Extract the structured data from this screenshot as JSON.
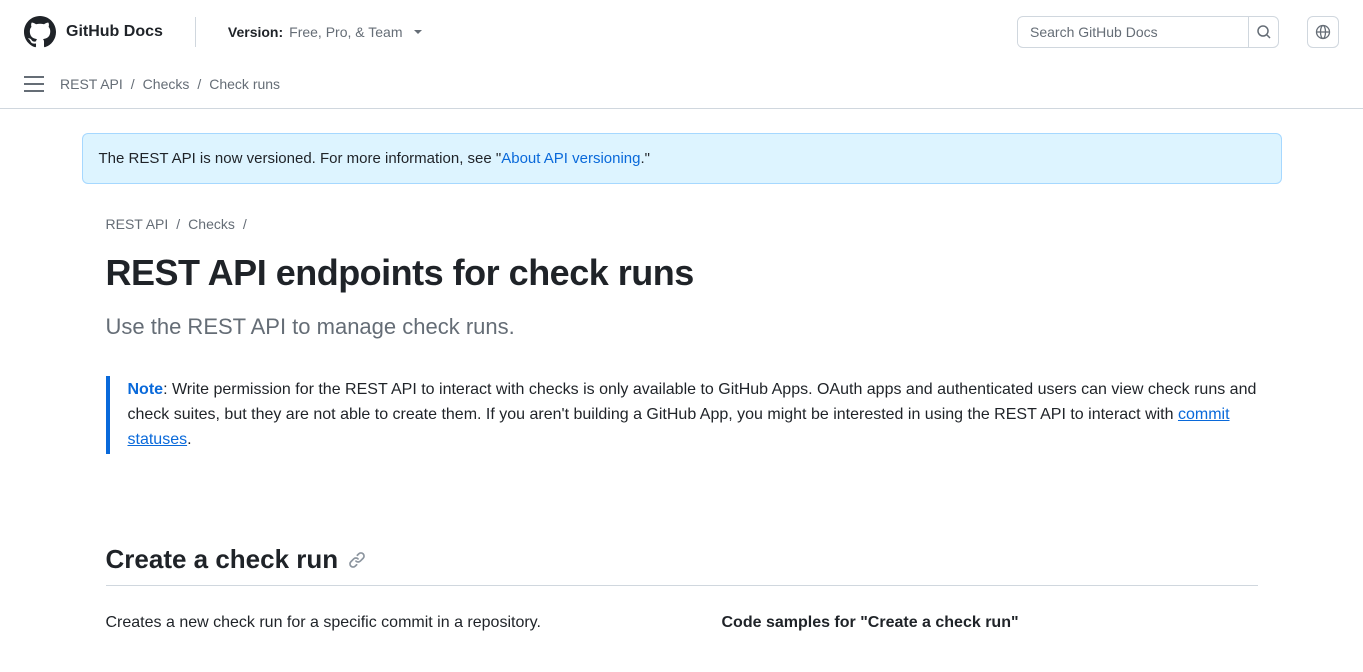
{
  "header": {
    "brand": "GitHub Docs",
    "version_label": "Version:",
    "version_value": "Free, Pro, & Team",
    "search_placeholder": "Search GitHub Docs"
  },
  "nav_crumbs": {
    "items": [
      "REST API",
      "Checks",
      "Check runs"
    ]
  },
  "banner": {
    "prefix": "The REST API is now versioned. For more information, see \"",
    "link_text": "About API versioning",
    "suffix": ".\""
  },
  "page_crumbs": {
    "items": [
      "REST API",
      "Checks"
    ]
  },
  "title": "REST API endpoints for check runs",
  "subtitle": "Use the REST API to manage check runs.",
  "note": {
    "tag": "Note",
    "body_before": ": Write permission for the REST API to interact with checks is only available to GitHub Apps. OAuth apps and authenticated users can view check runs and check suites, but they are not able to create them. If you aren't building a GitHub App, you might be interested in using the REST API to interact with ",
    "link_text": "commit statuses",
    "body_after": "."
  },
  "section": {
    "heading": "Create a check run",
    "left_text": "Creates a new check run for a specific commit in a repository.",
    "right_heading": "Code samples for \"Create a check run\""
  }
}
